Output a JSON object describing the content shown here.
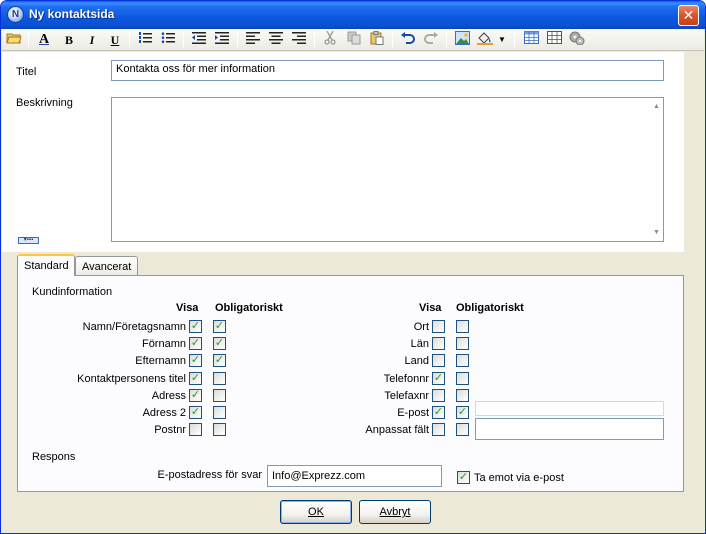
{
  "window": {
    "title": "Ny kontaktsida",
    "app_icon_letter": "N",
    "close_glyph": "✕"
  },
  "toolbar": {
    "icons": [
      "open-icon",
      "font-color-icon",
      "bold-icon",
      "italic-icon",
      "underline-icon",
      "numbered-list-icon",
      "bullet-list-icon",
      "outdent-icon",
      "indent-icon",
      "align-left-icon",
      "align-center-icon",
      "align-right-icon",
      "cut-icon",
      "copy-icon",
      "paste-icon",
      "undo-icon",
      "redo-icon",
      "image-icon",
      "fill-icon",
      "dropdown-icon",
      "table-icon",
      "table-grid-icon",
      "gear-icon"
    ],
    "bold": "B",
    "italic": "I",
    "underline": "U",
    "font_color": "A"
  },
  "form": {
    "title_label": "Titel",
    "title_value": "Kontakta oss för mer information",
    "description_label": "Beskrivning",
    "description_value": ""
  },
  "tabs": {
    "standard": "Standard",
    "advanced": "Avancerat"
  },
  "customer": {
    "group_label": "Kundinformation",
    "col_show": "Visa",
    "col_required": "Obligatoriskt",
    "left": [
      {
        "label": "Namn/Företagsnamn",
        "show": true,
        "required": true
      },
      {
        "label": "Förnamn",
        "show": true,
        "required": true
      },
      {
        "label": "Efternamn",
        "show": true,
        "required": true
      },
      {
        "label": "Kontaktpersonens titel",
        "show": true,
        "required": false
      },
      {
        "label": "Adress",
        "show": true,
        "required": false
      },
      {
        "label": "Adress 2",
        "show": true,
        "required": false
      },
      {
        "label": "Postnr",
        "show": false,
        "required": false
      }
    ],
    "right": [
      {
        "label": "Ort",
        "show": false,
        "required": false
      },
      {
        "label": "Län",
        "show": false,
        "required": false
      },
      {
        "label": "Land",
        "show": false,
        "required": false
      },
      {
        "label": "Telefonnr",
        "show": true,
        "required": false
      },
      {
        "label": "Telefaxnr",
        "show": false,
        "required": false
      },
      {
        "label": "E-post",
        "show": true,
        "required": true
      },
      {
        "label": "Anpassat fält",
        "show": false,
        "required": false
      }
    ],
    "email_extra_value": "",
    "custom_field_value": ""
  },
  "response": {
    "group_label": "Respons",
    "reply_email_label": "E-postadress för svar",
    "reply_email_value": "Info@Exprezz.com",
    "receive_email_label": "Ta emot via e-post",
    "receive_email_checked": true
  },
  "buttons": {
    "ok_label": "OK",
    "cancel_label": "Avbryt"
  },
  "colors": {
    "titlebar": "#0a5fdc",
    "check": "#21a121",
    "field_border": "#7f9db9",
    "tab_accent": "#ffc83c"
  }
}
